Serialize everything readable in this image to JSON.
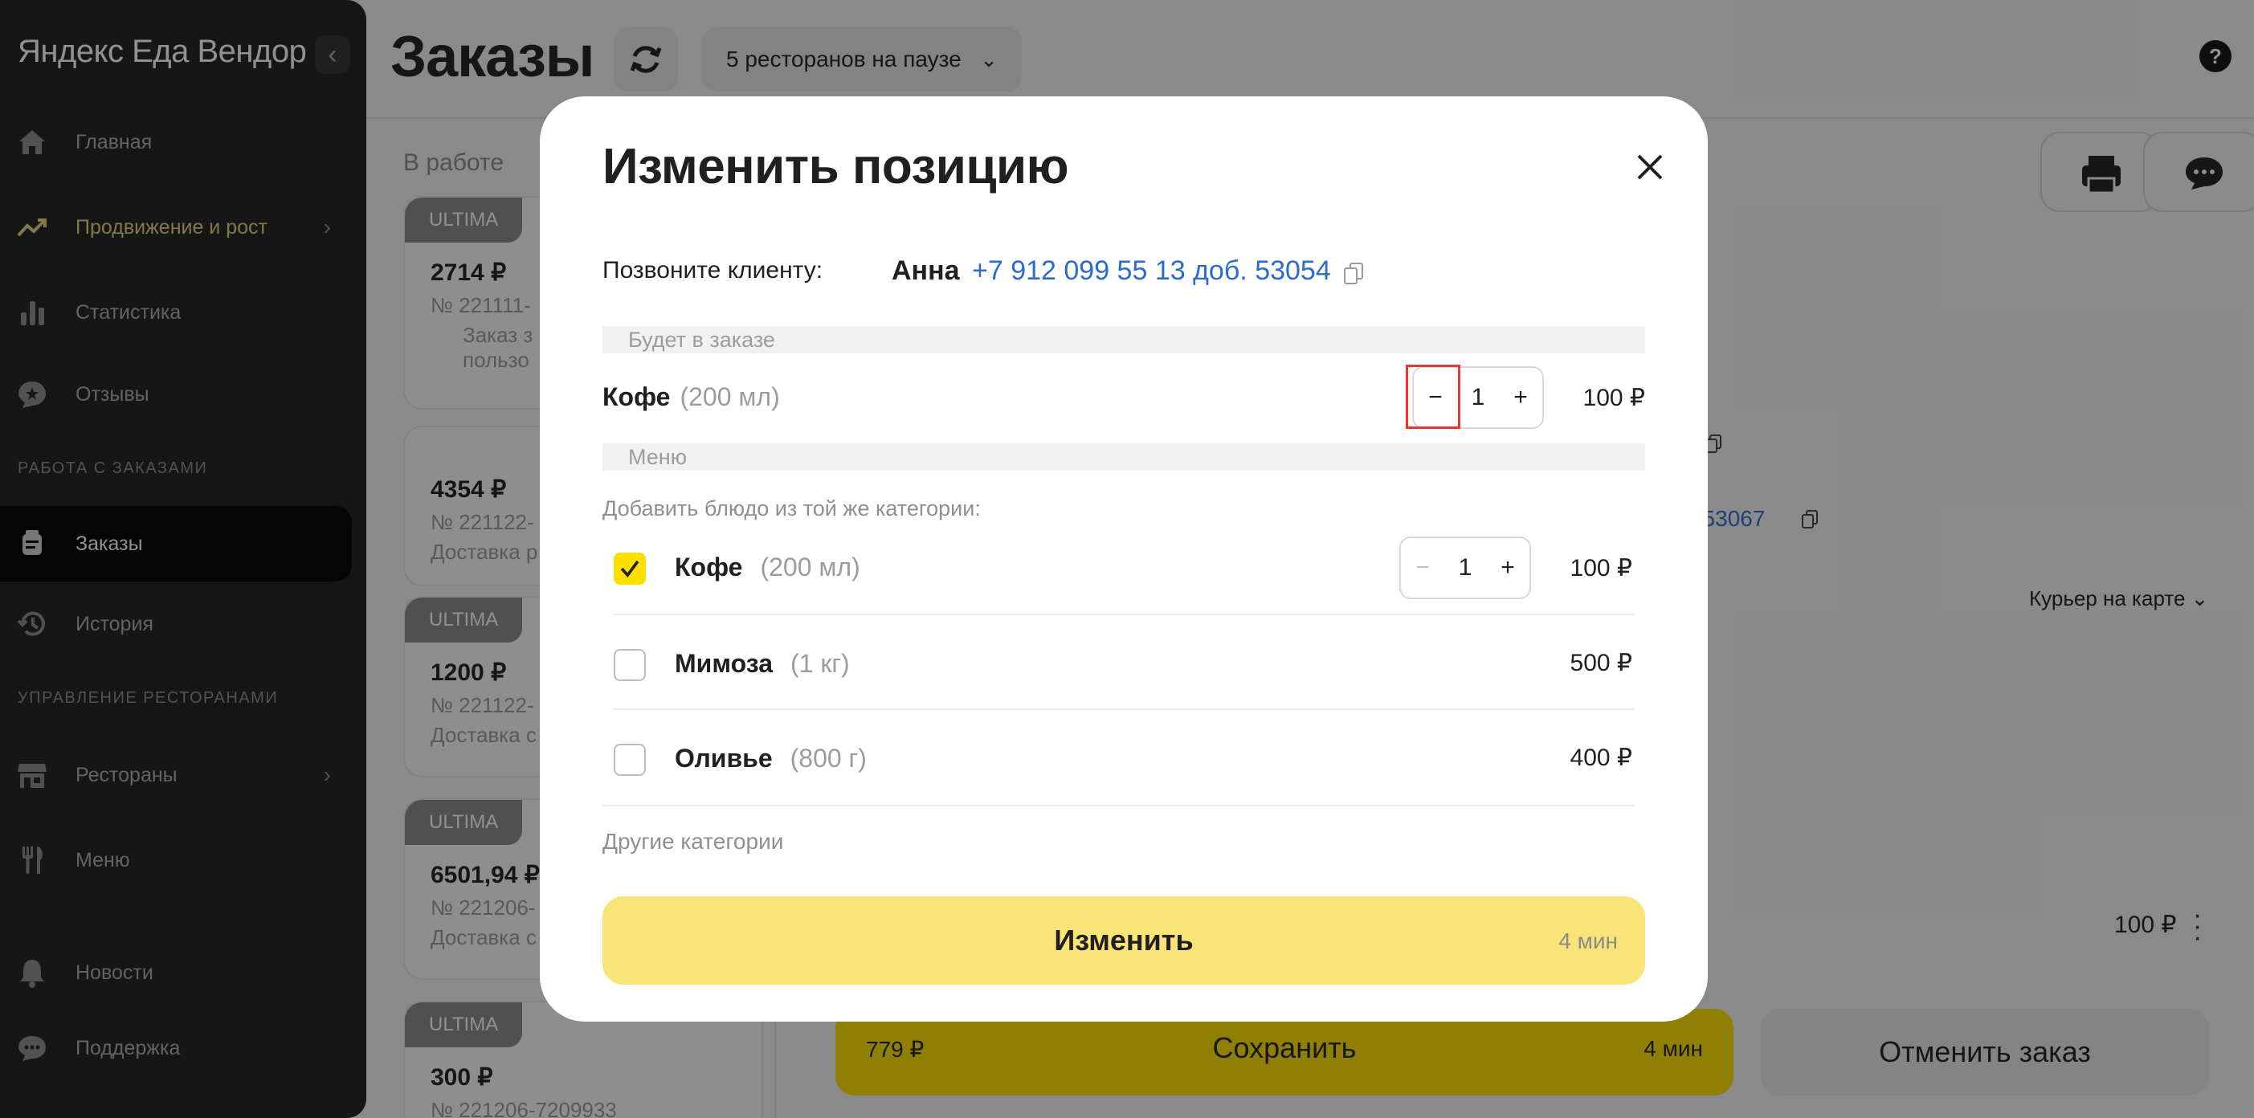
{
  "sidebar": {
    "brand": "Яндекс Еда Вендор",
    "collapse_glyph": "‹",
    "items": [
      {
        "label": "Главная",
        "icon": "home-icon"
      },
      {
        "label": "Продвижение и рост",
        "icon": "trend-up-icon"
      },
      {
        "label": "Статистика",
        "icon": "bar-chart-icon"
      },
      {
        "label": "Отзывы",
        "icon": "star-bubble-icon"
      },
      {
        "label": "Заказы",
        "icon": "orders-icon"
      },
      {
        "label": "История",
        "icon": "history-icon"
      },
      {
        "label": "Рестораны",
        "icon": "store-icon"
      },
      {
        "label": "Меню",
        "icon": "cutlery-icon"
      },
      {
        "label": "Новости",
        "icon": "bell-icon"
      },
      {
        "label": "Поддержка",
        "icon": "chat-icon"
      }
    ],
    "sections": [
      "РАБОТА С ЗАКАЗАМИ",
      "УПРАВЛЕНИЕ РЕСТОРАНАМИ"
    ],
    "chevron": "›"
  },
  "header": {
    "title": "Заказы",
    "pause_label": "5 ресторанов на паузе",
    "help": "?"
  },
  "orders": {
    "column_title": "В работе",
    "cards": [
      {
        "tag": "ULTIMA",
        "price": "2714 ₽",
        "number": "№ 221111-",
        "line1": "Заказ з",
        "line2": "пользо"
      },
      {
        "tag": "",
        "price": "4354 ₽",
        "number": "№ 221122-",
        "line1": "Доставка р",
        "line2": ""
      },
      {
        "tag": "ULTIMA",
        "price": "1200 ₽",
        "number": "№ 221122-",
        "line1": "Доставка с",
        "line2": ""
      },
      {
        "tag": "ULTIMA",
        "price": "6501,94 ₽",
        "number": "№ 221206-",
        "line1": "Доставка с",
        "line2": ""
      },
      {
        "tag": "ULTIMA",
        "price": "300 ₽",
        "number": "№ 221206-7209933",
        "line1": "",
        "line2": ""
      }
    ]
  },
  "background": {
    "phone_fragment": ". 53067",
    "courier_label": "Курьер на карте",
    "item_price": "100 ₽",
    "save": {
      "price": "779 ₽",
      "label": "Сохранить",
      "time": "4 мин"
    },
    "cancel_label": "Отменить заказ"
  },
  "modal": {
    "title": "Изменить позицию",
    "call_label": "Позвоните клиенту:",
    "client_name": "Анна",
    "client_phone": "+7 912 099 55 13 доб. 53054",
    "in_order_label": "Будет в заказе",
    "order_item": {
      "name": "Кофе",
      "size": "(200 мл)",
      "qty": "1",
      "price": "100 ₽"
    },
    "menu_label": "Меню",
    "add_label": "Добавить блюдо из той же категории:",
    "menu_items": [
      {
        "name": "Кофе",
        "size": "(200 мл)",
        "price": "100 ₽",
        "checked": true,
        "qty": "1"
      },
      {
        "name": "Мимоза",
        "size": "(1 кг)",
        "price": "500 ₽",
        "checked": false
      },
      {
        "name": "Оливье",
        "size": "(800 г)",
        "price": "400 ₽",
        "checked": false
      }
    ],
    "other_label": "Другие категории",
    "submit": {
      "label": "Изменить",
      "time": "4 мин"
    },
    "minus": "−",
    "plus": "+"
  },
  "colors": {
    "accent": "#fce000",
    "link": "#2e6bc8",
    "sidebar_bg": "#1f2020",
    "highlight": "#e53935"
  }
}
